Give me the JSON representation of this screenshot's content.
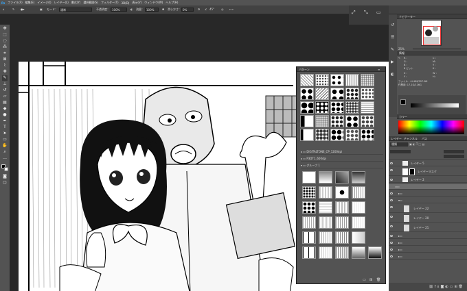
{
  "menu": [
    "ファイル(F)",
    "編集(E)",
    "イメージ(I)",
    "レイヤー(L)",
    "書式(Y)",
    "選択範囲(S)",
    "フィルター(T)",
    "3D(D)",
    "表示(V)",
    "ウィンドウ(W)",
    "ヘルプ(H)"
  ],
  "options": {
    "mode_label": "モード：",
    "mode_value": "通常",
    "opacity_label": "不透明度：",
    "opacity_value": "100%",
    "flow_label": "流量：",
    "flow_value": "100%",
    "smooth_label": "滑らかさ：",
    "smooth_value": "0%",
    "angle_value": "45°"
  },
  "navigator": {
    "title": "ナビゲーター",
    "zoom": "25%"
  },
  "info": {
    "title": "情報",
    "r": "R :",
    "g": "G :",
    "b": "B :",
    "c": "C :",
    "m": "M :",
    "y": "Y :",
    "k": "K :",
    "bits": "8 ビット",
    "x": "X :",
    "y2": "Y :",
    "w": "W :",
    "h": "H :",
    "file": "ファイル : 44.8M/307.9M",
    "doc": "作業用: 17.1G/116G"
  },
  "color": {
    "title": "カラー"
  },
  "layers": {
    "title": "レイヤー",
    "tabs": [
      "レイヤー",
      "チャンネル",
      "パス"
    ],
    "kind": "種類",
    "items": [
      "レイヤー 5",
      "レイヤーマスク",
      "レイヤー 2",
      "",
      "",
      "",
      "レイヤー 22",
      "レイヤー 20",
      "レイヤー 21",
      "",
      "",
      "",
      ""
    ]
  },
  "patterns": {
    "title": "パターン",
    "groups": [
      "DIGITALTONE_CP_1200dpi",
      "P3DT1_600dpi",
      "グループ 1"
    ]
  }
}
